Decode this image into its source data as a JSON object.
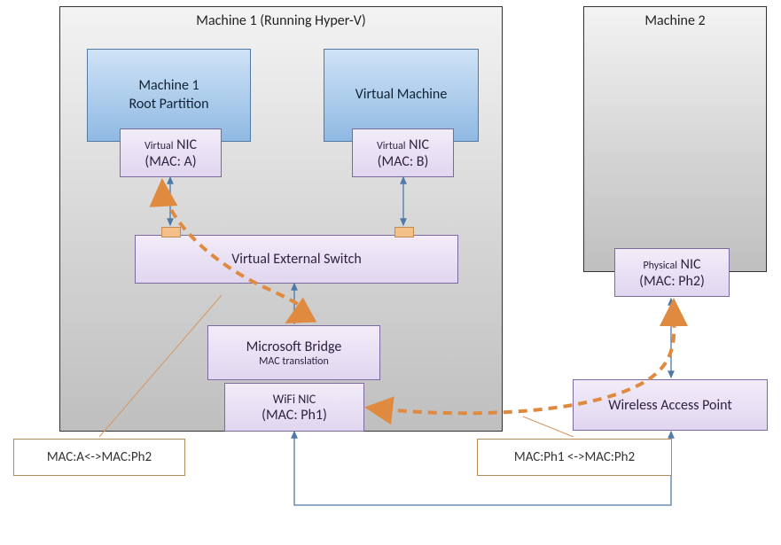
{
  "machine1": {
    "title": "Machine 1 (Running Hyper-V)",
    "root": {
      "label_line1": "Machine 1",
      "label_line2": "Root Partition",
      "nic_label_small": "Virtual",
      "nic_label_big": "NIC",
      "nic_mac": "(MAC: A)"
    },
    "vm": {
      "label": "Virtual Machine",
      "nic_label_small": "Virtual",
      "nic_label_big": "NIC",
      "nic_mac": "(MAC: B)"
    },
    "switch_label": "Virtual External Switch",
    "bridge": {
      "label": "Microsoft Bridge",
      "sub": "MAC translation"
    },
    "wifi": {
      "label": "WiFi NIC",
      "mac": "(MAC: Ph1)"
    }
  },
  "machine2": {
    "title": "Machine 2",
    "nic_label_small": "Physical",
    "nic_label_big": "NIC",
    "nic_mac": "(MAC: Ph2)"
  },
  "wap": {
    "label": "Wireless Access Point"
  },
  "annot": {
    "left": "MAC:A<->MAC:Ph2",
    "right": "MAC:Ph1 <->MAC:Ph2"
  }
}
